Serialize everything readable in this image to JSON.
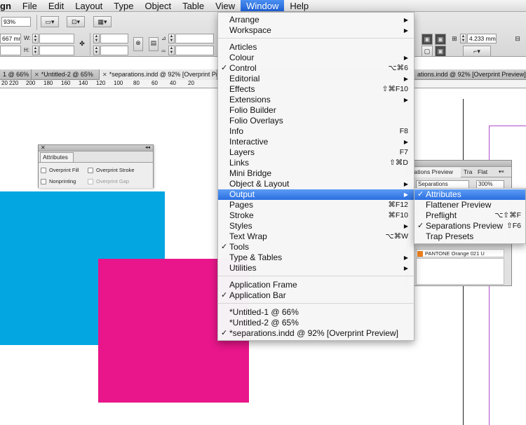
{
  "menubar": [
    "gn",
    "File",
    "Edit",
    "Layout",
    "Type",
    "Object",
    "Table",
    "View",
    "Window",
    "Help"
  ],
  "control": {
    "zoom": "93%",
    "x_value": "667 mm",
    "w_label": "W:",
    "h_label": "H:",
    "stroke_value": "4.233 mm"
  },
  "tabs": [
    "1 @ 66%",
    "*Untitled-2 @ 65%",
    "*separations.indd @ 92% [Overprint Preview]",
    "ations.indd @ 92% [Overprint Preview]"
  ],
  "ruler": [
    "20",
    "220",
    "200",
    "180",
    "160",
    "140",
    "120",
    "100",
    "80",
    "60",
    "40",
    "20"
  ],
  "attributes_panel": {
    "title": "Attributes",
    "options": [
      "Overprint Fill",
      "Overprint Stroke",
      "Nonprinting",
      "Overprint Gap"
    ]
  },
  "separations_panel": {
    "tab": "arations Preview",
    "tab2": "Tra",
    "tab3": "Flat",
    "view_value": "Separations",
    "zoom_value": "300%",
    "swatch_label": "PANTONE Orange 021 U"
  },
  "window_menu": {
    "items": [
      {
        "label": "Arrange",
        "shortcut": "",
        "check": false,
        "sub": true
      },
      {
        "label": "Workspace",
        "shortcut": "",
        "check": false,
        "sub": true
      },
      {
        "label": "Articles",
        "shortcut": "",
        "check": false,
        "sub": false
      },
      {
        "label": "Colour",
        "shortcut": "",
        "check": false,
        "sub": true
      },
      {
        "label": "Control",
        "shortcut": "⌥⌘6",
        "check": true,
        "sub": false
      },
      {
        "label": "Editorial",
        "shortcut": "",
        "check": false,
        "sub": true
      },
      {
        "label": "Effects",
        "shortcut": "⇧⌘F10",
        "check": false,
        "sub": false
      },
      {
        "label": "Extensions",
        "shortcut": "",
        "check": false,
        "sub": true
      },
      {
        "label": "Folio Builder",
        "shortcut": "",
        "check": false,
        "sub": false
      },
      {
        "label": "Folio Overlays",
        "shortcut": "",
        "check": false,
        "sub": false
      },
      {
        "label": "Info",
        "shortcut": "F8",
        "check": false,
        "sub": false
      },
      {
        "label": "Interactive",
        "shortcut": "",
        "check": false,
        "sub": true
      },
      {
        "label": "Layers",
        "shortcut": "F7",
        "check": false,
        "sub": false
      },
      {
        "label": "Links",
        "shortcut": "⇧⌘D",
        "check": false,
        "sub": false
      },
      {
        "label": "Mini Bridge",
        "shortcut": "",
        "check": false,
        "sub": false
      },
      {
        "label": "Object & Layout",
        "shortcut": "",
        "check": false,
        "sub": true
      },
      {
        "label": "Output",
        "shortcut": "",
        "check": false,
        "sub": true,
        "highlight": true
      },
      {
        "label": "Pages",
        "shortcut": "⌘F12",
        "check": false,
        "sub": false
      },
      {
        "label": "Stroke",
        "shortcut": "⌘F10",
        "check": false,
        "sub": false
      },
      {
        "label": "Styles",
        "shortcut": "",
        "check": false,
        "sub": true
      },
      {
        "label": "Text Wrap",
        "shortcut": "⌥⌘W",
        "check": false,
        "sub": false
      },
      {
        "label": "Tools",
        "shortcut": "",
        "check": true,
        "sub": false
      },
      {
        "label": "Type & Tables",
        "shortcut": "",
        "check": false,
        "sub": true
      },
      {
        "label": "Utilities",
        "shortcut": "",
        "check": false,
        "sub": true
      },
      {
        "label": "Application Frame",
        "shortcut": "",
        "check": false,
        "sub": false
      },
      {
        "label": "Application Bar",
        "shortcut": "",
        "check": true,
        "sub": false
      },
      {
        "label": "*Untitled-1 @ 66%",
        "shortcut": "",
        "check": false,
        "sub": false
      },
      {
        "label": "*Untitled-2 @ 65%",
        "shortcut": "",
        "check": false,
        "sub": false
      },
      {
        "label": "*separations.indd @ 92% [Overprint Preview]",
        "shortcut": "",
        "check": true,
        "sub": false
      }
    ]
  },
  "output_submenu": {
    "items": [
      {
        "label": "Attributes",
        "shortcut": "",
        "check": true,
        "highlight": true
      },
      {
        "label": "Flattener Preview",
        "shortcut": "",
        "check": false
      },
      {
        "label": "Preflight",
        "shortcut": "⌥⇧⌘F",
        "check": false
      },
      {
        "label": "Separations Preview",
        "shortcut": "⇧F6",
        "check": true
      },
      {
        "label": "Trap Presets",
        "shortcut": "",
        "check": false
      }
    ]
  },
  "colors": {
    "cyan": "#04a6e1",
    "magenta": "#e8168a",
    "highlight": "#2a6ee0",
    "orange_swatch": "#f0821e"
  }
}
